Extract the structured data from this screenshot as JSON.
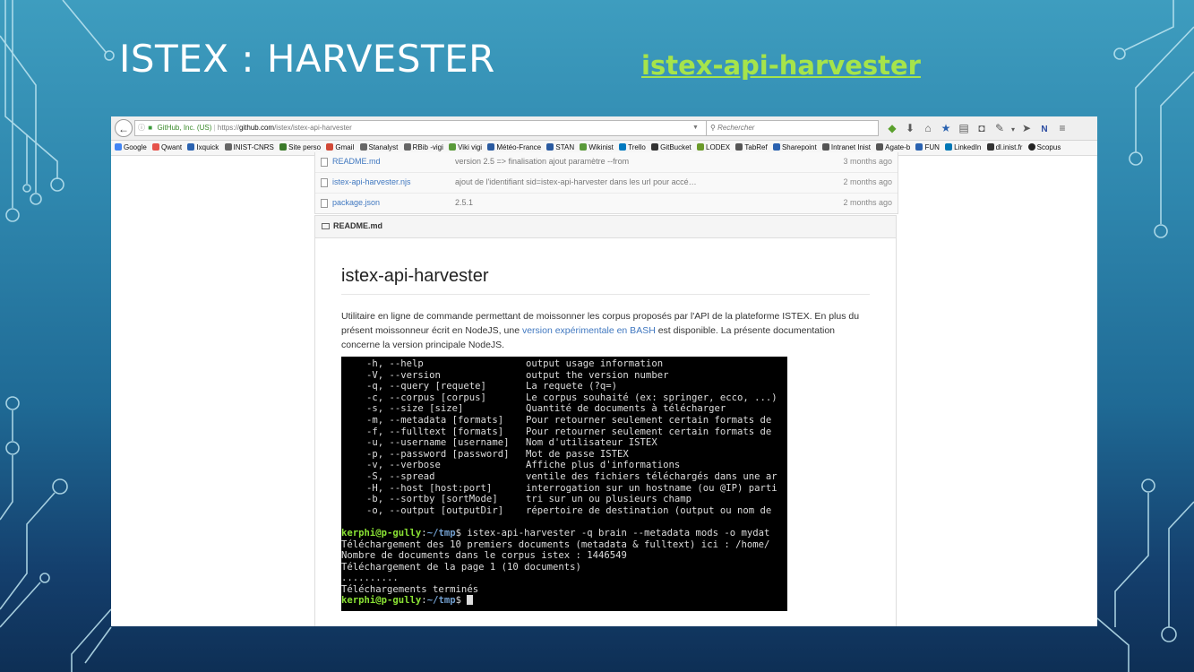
{
  "slide": {
    "title": "ISTEX : HARVESTER",
    "link_text": "istex-api-harvester"
  },
  "browser": {
    "identity": "GitHub, Inc. (US)",
    "url_prefix": "https://",
    "url_domain": "github.com",
    "url_path": "/istex/istex-api-harvester",
    "search_placeholder": "Rechercher",
    "info_icon": "info-icon",
    "lock_icon": "lock-icon",
    "reload_icon": "reload-icon",
    "toolbar_icons": [
      "refresh-green-icon",
      "download-icon",
      "home-icon",
      "bookmark-star-icon",
      "reader-icon",
      "pocket-icon",
      "wrench-icon",
      "dropdown-icon",
      "send-icon",
      "n-icon",
      "menu-icon"
    ]
  },
  "bookmarks": [
    {
      "label": "Google",
      "color": "#4285f4"
    },
    {
      "label": "Qwant",
      "color": "#e6534b"
    },
    {
      "label": "Ixquick",
      "color": "#2a62b0"
    },
    {
      "label": "INIST-CNRS",
      "color": "#666666"
    },
    {
      "label": "Site perso",
      "color": "#3b7a2a"
    },
    {
      "label": "Gmail",
      "color": "#d14836"
    },
    {
      "label": "Stanalyst",
      "color": "#666666"
    },
    {
      "label": "RBib -vigi",
      "color": "#666666"
    },
    {
      "label": "Viki vigi",
      "color": "#5a9a3a"
    },
    {
      "label": "Météo-France",
      "color": "#2a5aa0"
    },
    {
      "label": "STAN",
      "color": "#2a5aa0"
    },
    {
      "label": "Wikinist",
      "color": "#5a9a3a"
    },
    {
      "label": "Trello",
      "color": "#0079bf"
    },
    {
      "label": "GitBucket",
      "color": "#333333"
    },
    {
      "label": "LODEX",
      "color": "#6a9a2a"
    },
    {
      "label": "TabRef",
      "color": "#555555"
    },
    {
      "label": "Sharepoint",
      "color": "#2a62b0"
    },
    {
      "label": "Intranet Inist",
      "color": "#555555"
    },
    {
      "label": "Agate-b",
      "color": "#555555"
    },
    {
      "label": "FUN",
      "color": "#2a62b0"
    },
    {
      "label": "LinkedIn",
      "color": "#0077b5"
    },
    {
      "label": "dl.inist.fr",
      "color": "#333333"
    },
    {
      "label": "Scopus",
      "color": "#222222"
    }
  ],
  "files": [
    {
      "name": "README.md",
      "message": "version 2.5 => finalisation ajout paramètre --from",
      "age": "3 months ago"
    },
    {
      "name": "istex-api-harvester.njs",
      "message": "ajout de l'identifiant sid=istex-api-harvester dans les url pour accé…",
      "age": "2 months ago"
    },
    {
      "name": "package.json",
      "message": "2.5.1",
      "age": "2 months ago"
    }
  ],
  "readme": {
    "header_label": "README.md",
    "title": "istex-api-harvester",
    "para_before_link": "Utilitaire en ligne de commande permettant de moissonner les corpus proposés par l'API de la plateforme ISTEX. En plus du présent moissonneur écrit en NodeJS, une ",
    "para_link": "version expérimentale en BASH",
    "para_after_link": " est disponible. La présente documentation concerne la version principale NodeJS."
  },
  "terminal": {
    "options": [
      {
        "opt": "-h, --help",
        "desc": "output usage information"
      },
      {
        "opt": "-V, --version",
        "desc": "output the version number"
      },
      {
        "opt": "-q, --query [requete]",
        "desc": "La requete (?q=)"
      },
      {
        "opt": "-c, --corpus [corpus]",
        "desc": "Le corpus souhaité (ex: springer, ecco, ...)"
      },
      {
        "opt": "-s, --size [size]",
        "desc": "Quantité de documents à télécharger"
      },
      {
        "opt": "-m, --metadata [formats]",
        "desc": "Pour retourner seulement certain formats de"
      },
      {
        "opt": "-f, --fulltext [formats]",
        "desc": "Pour retourner seulement certain formats de"
      },
      {
        "opt": "-u, --username [username]",
        "desc": "Nom d'utilisateur ISTEX"
      },
      {
        "opt": "-p, --password [password]",
        "desc": "Mot de passe ISTEX"
      },
      {
        "opt": "-v, --verbose",
        "desc": "Affiche plus d'informations"
      },
      {
        "opt": "-S, --spread",
        "desc": "ventile des fichiers téléchargés dans une ar"
      },
      {
        "opt": "-H, --host [host:port]",
        "desc": "interrogation sur un hostname (ou @IP) parti"
      },
      {
        "opt": "-b, --sortby [sortMode]",
        "desc": "tri sur un ou plusieurs champ"
      },
      {
        "opt": "-o, --output [outputDir]",
        "desc": "répertoire de destination (output ou nom de"
      }
    ],
    "prompt_user": "kerphi@p-gully",
    "prompt_sep": ":",
    "prompt_path": "~/tmp",
    "prompt_end": "$",
    "command": " istex-api-harvester -q brain --metadata mods -o mydat",
    "output": [
      "Téléchargement des 10 premiers documents (metadata & fulltext) ici : /home/",
      "Nombre de documents dans le corpus istex : 1446549",
      "Téléchargement de la page 1 (10 documents)",
      "..........",
      "Téléchargements terminés"
    ]
  },
  "colors": {
    "link_green": "#a6e44a",
    "terminal_green": "#8ae234",
    "terminal_blue": "#729fcf"
  }
}
